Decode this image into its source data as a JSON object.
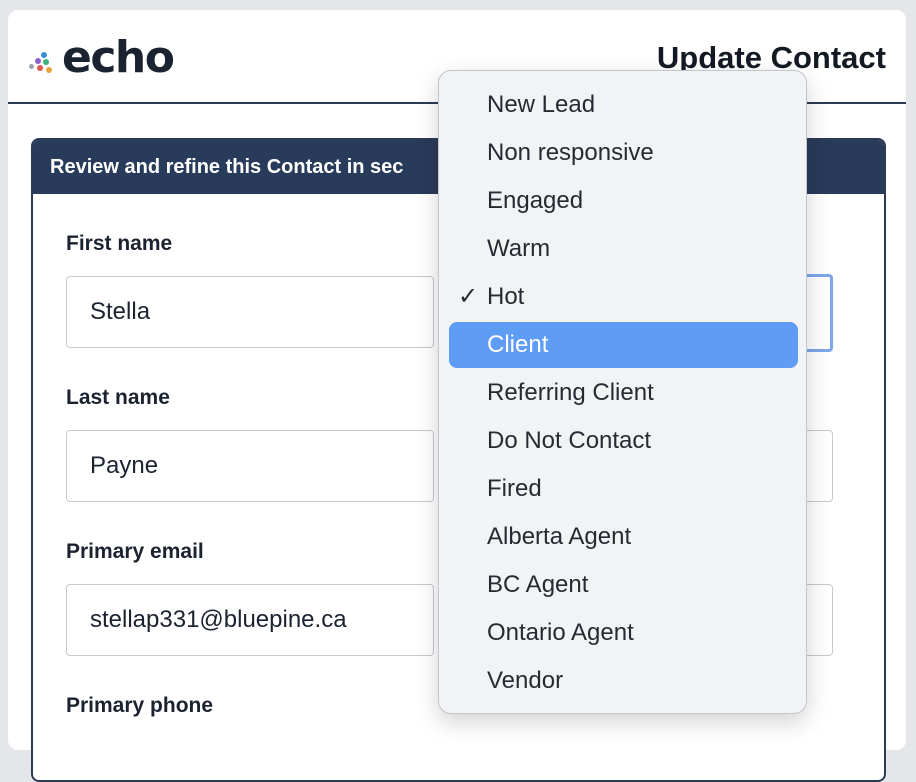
{
  "brand": {
    "name": "echo"
  },
  "page_title": "Update Contact",
  "panel": {
    "heading": "Review and refine this Contact in sec"
  },
  "form": {
    "first_name": {
      "label": "First name",
      "value": "Stella"
    },
    "last_name": {
      "label": "Last name",
      "value": "Payne"
    },
    "primary_email": {
      "label": "Primary email",
      "value": "stellap331@bluepine.ca"
    },
    "primary_phone": {
      "label": "Primary phone"
    }
  },
  "status_menu": {
    "checked": "Hot",
    "highlighted": "Client",
    "check_glyph": "✓",
    "options": [
      "New Lead",
      "Non responsive",
      "Engaged",
      "Warm",
      "Hot",
      "Client",
      "Referring Client",
      "Do Not Contact",
      "Fired",
      "Alberta Agent",
      "BC Agent",
      "Ontario Agent",
      "Vendor"
    ]
  },
  "colors": {
    "panel_header_bg": "#293b5a",
    "highlight": "#5e9cf6",
    "focus_ring": "#7ea6ea",
    "logo_dots": [
      "#3a8bd6",
      "#3cb37a",
      "#e8a33d",
      "#e05a4f",
      "#8a5fc7",
      "#9aa3ad"
    ]
  }
}
